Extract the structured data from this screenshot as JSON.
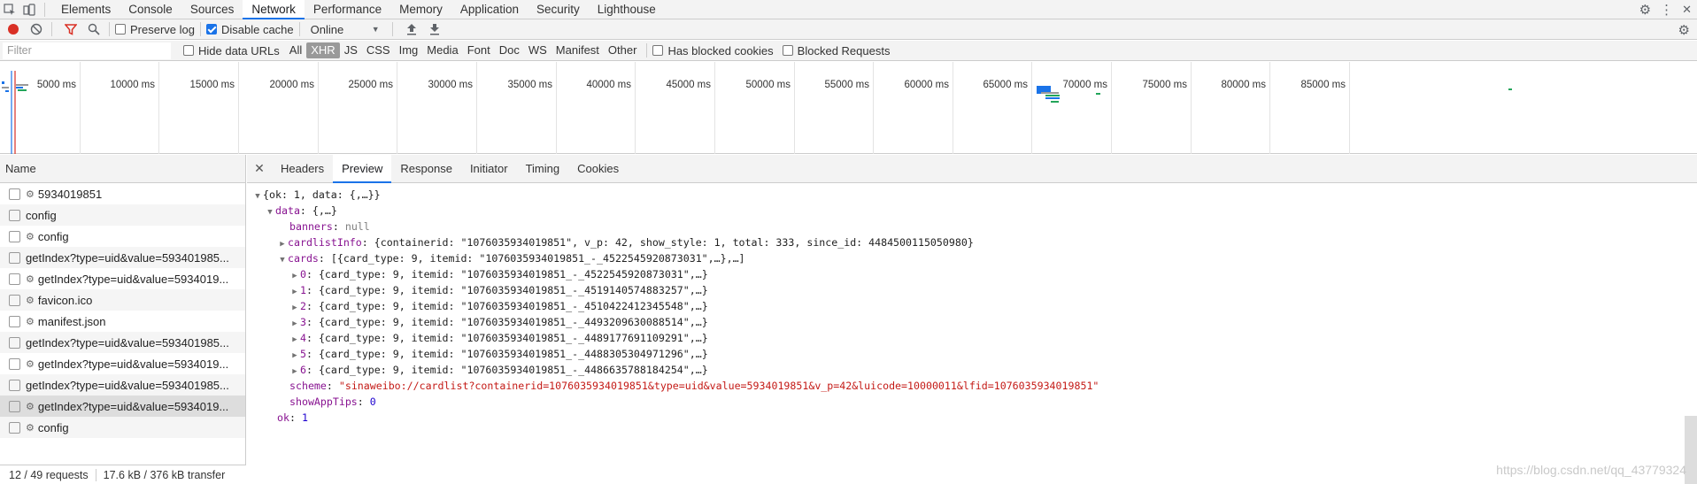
{
  "panel_tabs": [
    "Elements",
    "Console",
    "Sources",
    "Network",
    "Performance",
    "Memory",
    "Application",
    "Security",
    "Lighthouse"
  ],
  "toolbar": {
    "preserve_log": "Preserve log",
    "disable_cache": "Disable cache",
    "throttling": "Online"
  },
  "filter": {
    "placeholder": "Filter",
    "hide_data_urls": "Hide data URLs",
    "types": [
      "All",
      "XHR",
      "JS",
      "CSS",
      "Img",
      "Media",
      "Font",
      "Doc",
      "WS",
      "Manifest",
      "Other"
    ],
    "active_type": "XHR",
    "has_blocked_cookies": "Has blocked cookies",
    "blocked_requests": "Blocked Requests"
  },
  "overview": {
    "ticks": [
      "5000 ms",
      "10000 ms",
      "15000 ms",
      "20000 ms",
      "25000 ms",
      "30000 ms",
      "35000 ms",
      "40000 ms",
      "45000 ms",
      "50000 ms",
      "55000 ms",
      "60000 ms",
      "65000 ms",
      "70000 ms",
      "75000 ms",
      "80000 ms",
      "85000 ms"
    ]
  },
  "requests": {
    "header": "Name",
    "items": [
      {
        "name": "5934019851",
        "gear": true
      },
      {
        "name": "config",
        "gear": false
      },
      {
        "name": "config",
        "gear": true
      },
      {
        "name": "getIndex?type=uid&value=593401985...",
        "gear": false
      },
      {
        "name": "getIndex?type=uid&value=5934019...",
        "gear": true
      },
      {
        "name": "favicon.ico",
        "gear": true
      },
      {
        "name": "manifest.json",
        "gear": true
      },
      {
        "name": "getIndex?type=uid&value=593401985...",
        "gear": false
      },
      {
        "name": "getIndex?type=uid&value=5934019...",
        "gear": true
      },
      {
        "name": "getIndex?type=uid&value=593401985...",
        "gear": false
      },
      {
        "name": "getIndex?type=uid&value=5934019...",
        "gear": true
      },
      {
        "name": "config",
        "gear": true
      }
    ],
    "selected_index": 10,
    "status_requests": "12 / 49 requests",
    "status_transfer": "17.6 kB / 376 kB transfer"
  },
  "detail": {
    "tabs": [
      "Headers",
      "Preview",
      "Response",
      "Initiator",
      "Timing",
      "Cookies"
    ],
    "active_tab": "Preview"
  },
  "preview": {
    "root": "{ok: 1, data: {,…}}",
    "data_summary": "{,…}",
    "banners_value": "null",
    "cardlist_summary": "{containerid: \"1076035934019851\", v_p: 42, show_style: 1, total: 333, since_id: 4484500115050980}",
    "cards_summary": "[{card_type: 9, itemid: \"1076035934019851_-_4522545920873031\",…},…]",
    "cards": [
      "{card_type: 9, itemid: \"1076035934019851_-_4522545920873031\",…}",
      "{card_type: 9, itemid: \"1076035934019851_-_4519140574883257\",…}",
      "{card_type: 9, itemid: \"1076035934019851_-_4510422412345548\",…}",
      "{card_type: 9, itemid: \"1076035934019851_-_4493209630088514\",…}",
      "{card_type: 9, itemid: \"1076035934019851_-_4489177691109291\",…}",
      "{card_type: 9, itemid: \"1076035934019851_-_4488305304971296\",…}",
      "{card_type: 9, itemid: \"1076035934019851_-_4486635788184254\",…}"
    ],
    "scheme_value": "\"sinaweibo://cardlist?containerid=1076035934019851&type=uid&value=5934019851&v_p=42&luicode=10000011&lfid=1076035934019851\"",
    "showapptips_value": "0",
    "ok_value": "1"
  },
  "watermark": "https://blog.csdn.net/qq_43779324"
}
